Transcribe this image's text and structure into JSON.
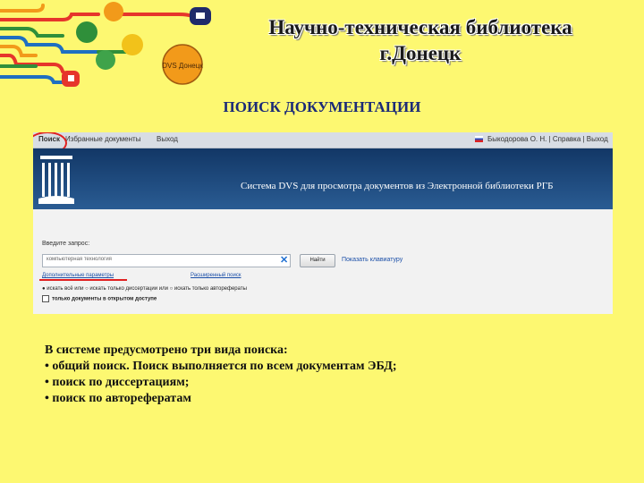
{
  "slide": {
    "title_line1": "Научно-техническая библиотека",
    "title_line2": "г.Донецк",
    "subtitle": "ПОИСК ДОКУМЕНТАЦИИ",
    "logo_text": "DVS Донецк",
    "bullets": [
      "В системе предусмотрено три вида поиска:",
      "• общий поиск. Поиск выполняется по всем документам ЭБД;",
      "• поиск по диссертациям;",
      "• поиск по авторефератам"
    ]
  },
  "screenshot": {
    "nav": {
      "item1": "Поиск",
      "item2": "Избранные документы",
      "item3": "Выход",
      "user_line": "Быкодорова О. Н. | Справка | Выход"
    },
    "banner_text": "Система DVS для просмотра документов из Электронной библиотеки РГБ",
    "query_label": "Введите запрос:",
    "query_value": "компьютерная технология",
    "find_button": "Найти",
    "keyboard_link": "Показать клавиатуру",
    "advanced_link": "Дополнительные параметры",
    "extended_link": "Расширенный поиск",
    "radio_line": "● искать всё или ○ искать только диссертации или ○ искать только авторефераты",
    "open_access": "только документы в открытом доступе"
  },
  "colors": {
    "slide_background": "#fdf871",
    "banner_blue": "#1f4a7d",
    "highlight_red": "#e02020",
    "subtitle_blue": "#1b2a78"
  }
}
